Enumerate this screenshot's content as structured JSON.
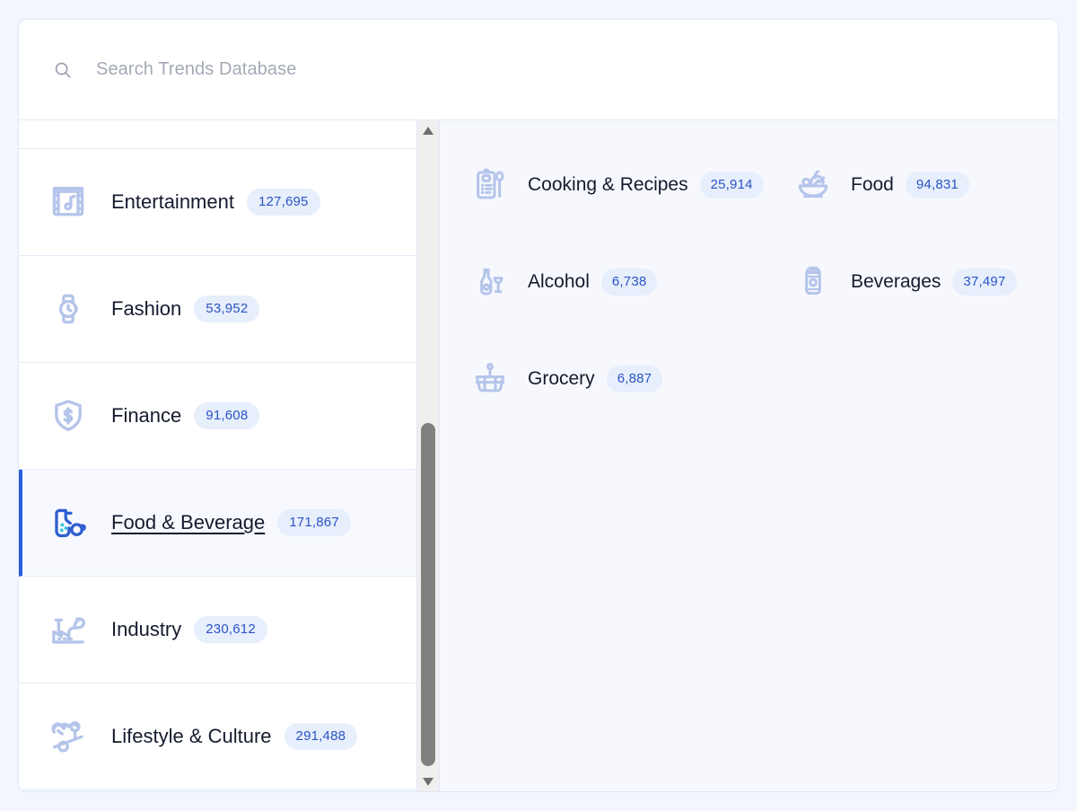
{
  "search": {
    "placeholder": "Search Trends Database",
    "value": "",
    "icon": "search-icon"
  },
  "colors": {
    "accent": "#2b5fd9",
    "badge_bg": "#e7eefc",
    "badge_text": "#2a55c4",
    "icon_muted": "#b4c4ea",
    "panel_bg": "#f6f8fd",
    "page_bg": "#f3f6fd"
  },
  "categories": {
    "items": [
      {
        "label": "Entertainment",
        "count": "127,695",
        "icon": "film-music-icon",
        "selected": false
      },
      {
        "label": "Fashion",
        "count": "53,952",
        "icon": "watch-icon",
        "selected": false
      },
      {
        "label": "Finance",
        "count": "91,608",
        "icon": "shield-dollar-icon",
        "selected": false
      },
      {
        "label": "Food & Beverage",
        "count": "171,867",
        "icon": "drink-pour-icon",
        "selected": true
      },
      {
        "label": "Industry",
        "count": "230,612",
        "icon": "factory-leaf-icon",
        "selected": false
      },
      {
        "label": "Lifestyle & Culture",
        "count": "291,488",
        "icon": "heart-balance-icon",
        "selected": false
      }
    ]
  },
  "scrollbar": {
    "up_icon": "triangle-up-icon",
    "down_icon": "triangle-down-icon",
    "thumb": "scrollbar-thumb"
  },
  "subcategories": {
    "items": [
      {
        "label": "Cooking & Recipes",
        "count": "25,914",
        "icon": "recipe-card-spoon-icon"
      },
      {
        "label": "Food",
        "count": "94,831",
        "icon": "salad-bowl-icon"
      },
      {
        "label": "Alcohol",
        "count": "6,738",
        "icon": "bottle-wineglass-icon"
      },
      {
        "label": "Beverages",
        "count": "37,497",
        "icon": "soda-can-icon"
      },
      {
        "label": "Grocery",
        "count": "6,887",
        "icon": "shopping-basket-icon"
      }
    ]
  }
}
